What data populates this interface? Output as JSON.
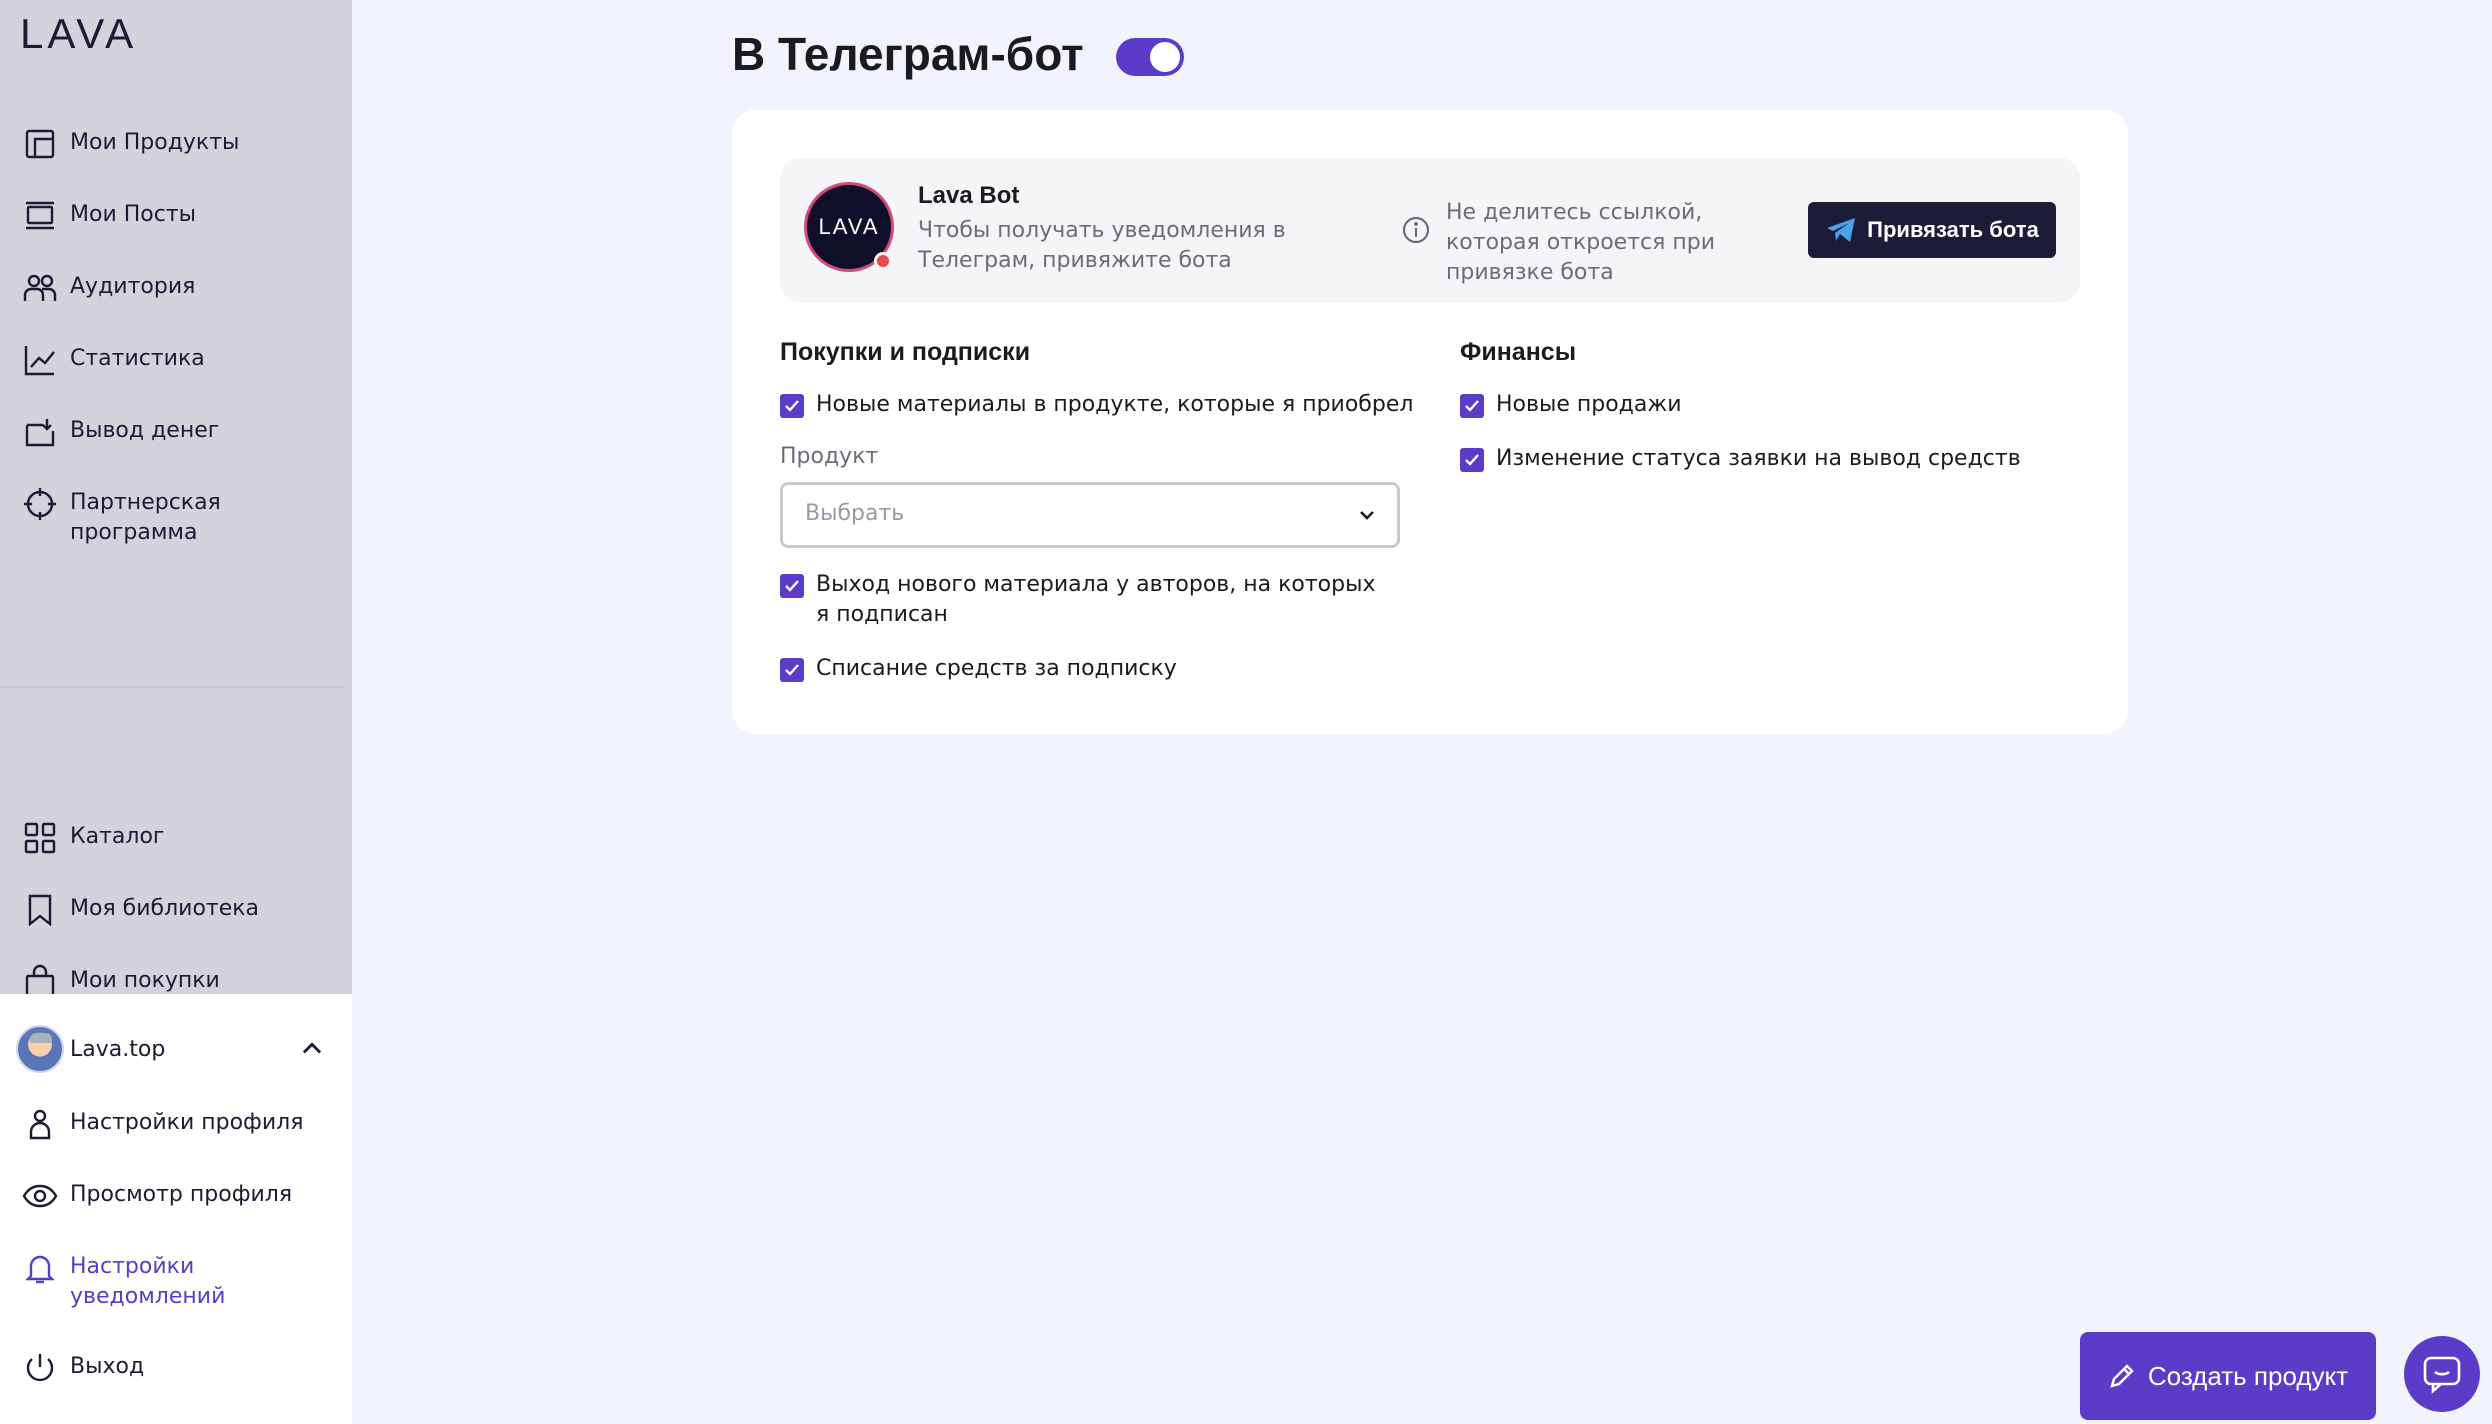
{
  "brand": {
    "logo_text": "LAVA"
  },
  "sidebar": {
    "items": [
      {
        "label": "Мои Продукты",
        "icon": "products-icon"
      },
      {
        "label": "Мои Посты",
        "icon": "posts-icon"
      },
      {
        "label": "Аудитория",
        "icon": "audience-icon"
      },
      {
        "label": "Статистика",
        "icon": "stats-icon"
      },
      {
        "label": "Вывод денег",
        "icon": "withdraw-icon"
      },
      {
        "label": "Партнерская программа",
        "icon": "partner-icon"
      }
    ],
    "secondary_items": [
      {
        "label": "Каталог",
        "icon": "grid-icon"
      },
      {
        "label": "Моя библиотека",
        "icon": "bookmark-icon"
      },
      {
        "label": "Мои покупки",
        "icon": "bag-icon"
      }
    ],
    "profile": {
      "name": "Lava.top",
      "menu": [
        {
          "label": "Настройки профиля",
          "icon": "user-icon"
        },
        {
          "label": "Просмотр профиля",
          "icon": "eye-icon"
        },
        {
          "label": "Настройки уведомлений",
          "icon": "bell-icon",
          "active": true
        },
        {
          "label": "Выход",
          "icon": "power-icon"
        }
      ]
    }
  },
  "main": {
    "title": "В Телеграм-бот",
    "toggle_on": true,
    "bot": {
      "avatar_text": "LAVA",
      "name": "Lava Bot",
      "description": "Чтобы получать уведомления в Телеграм, привяжите бота",
      "note": "Не делитесь ссылкой, которая откроется при привязке бота",
      "bind_button": "Привязать бота"
    },
    "purchases": {
      "title": "Покупки и подписки",
      "new_materials": "Новые материалы в продукте, которые я приобрел",
      "product_label": "Продукт",
      "product_placeholder": "Выбрать",
      "new_from_authors": "Выход нового материала у авторов, на которых я подписан",
      "subscription_charge": "Списание средств за подписку"
    },
    "finance": {
      "title": "Финансы",
      "new_sales": "Новые продажи",
      "withdraw_status": "Изменение статуса заявки на вывод средств"
    }
  },
  "actions": {
    "create_product": "Создать продукт"
  },
  "colors": {
    "accent": "#5b3cc8",
    "dark": "#1c1b38",
    "sidebar_bg": "#d3d3db",
    "page_bg": "#f2f4fd"
  }
}
